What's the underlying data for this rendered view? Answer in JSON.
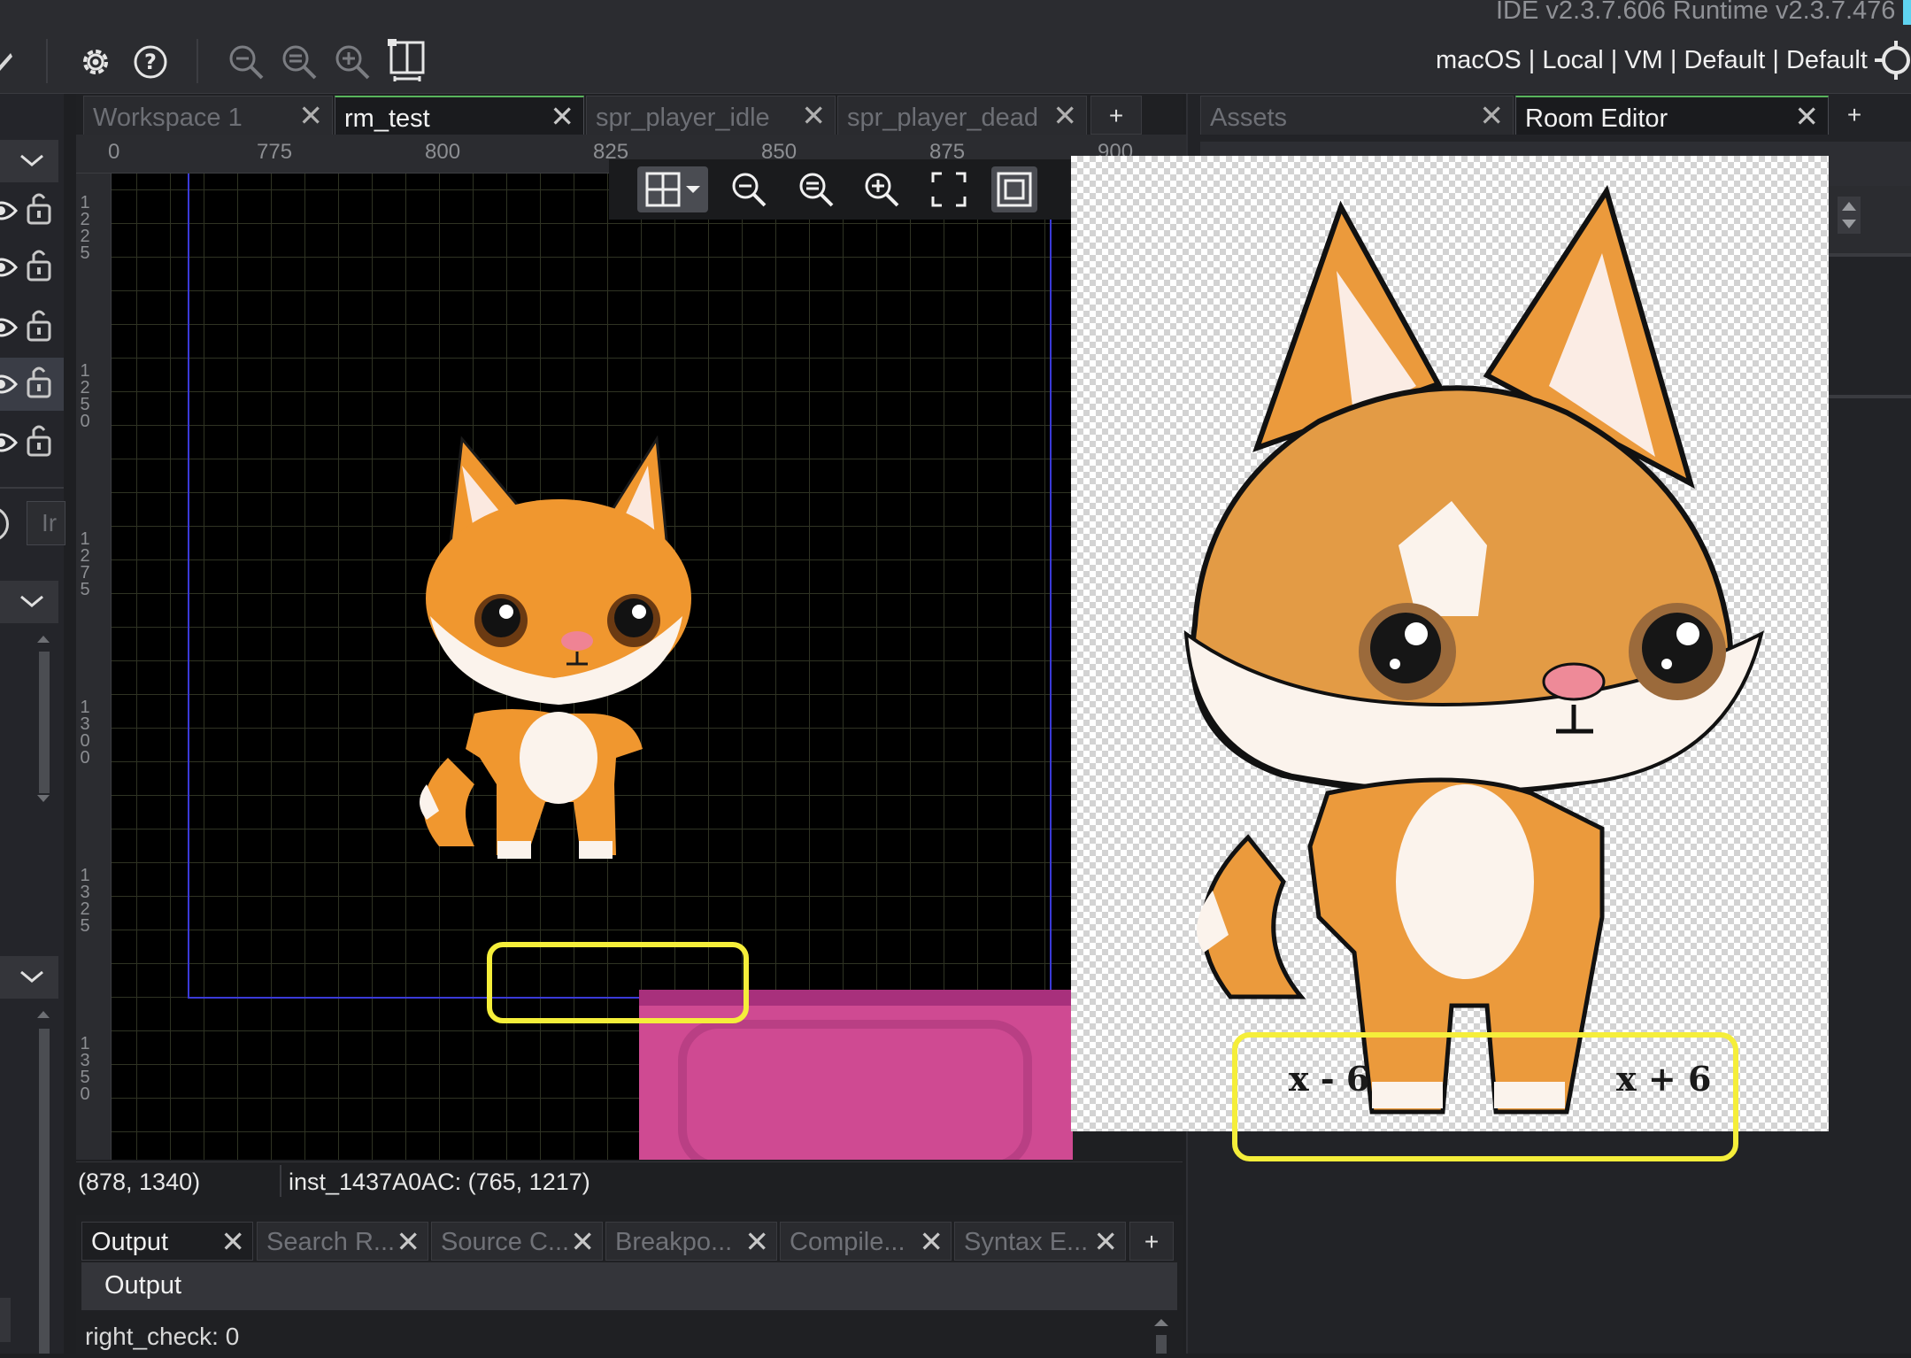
{
  "version_text": "IDE v2.3.7.606  Runtime v2.3.7.476",
  "target_text": "macOS | Local | VM | Default | Default",
  "toolbar": {
    "icons": [
      "gear-icon",
      "help-icon",
      "zoom-out-icon",
      "zoom-reset-icon",
      "zoom-in-icon",
      "grid-layout-icon",
      "target-icon"
    ]
  },
  "workspace_tabs": [
    {
      "label": "Workspace 1",
      "close": "✕"
    },
    {
      "label": "rm_test",
      "close": "✕"
    },
    {
      "label": "spr_player_idle",
      "close": "✕"
    },
    {
      "label": "spr_player_dead",
      "close": "✕"
    }
  ],
  "add_tab": "+",
  "right_tabs": [
    {
      "label": "Assets",
      "close": "✕"
    },
    {
      "label": "Room Editor",
      "close": "✕"
    }
  ],
  "h_ruler": [
    "0",
    "775",
    "800",
    "825",
    "850",
    "875",
    "900"
  ],
  "v_ruler": [
    "1225",
    "1250",
    "1275",
    "1300",
    "1325",
    "1350"
  ],
  "left_panel_field": "Ir",
  "status": {
    "cursor": "(878, 1340)",
    "instance": "inst_1437A0AC: (765, 1217)"
  },
  "output_tabs": [
    {
      "label": "Output",
      "close": "✕"
    },
    {
      "label": "Search R...",
      "close": "✕"
    },
    {
      "label": "Source C...",
      "close": "✕"
    },
    {
      "label": "Breakpo...",
      "close": "✕"
    },
    {
      "label": "Compile...",
      "close": "✕"
    },
    {
      "label": "Syntax E...",
      "close": "✕"
    }
  ],
  "output_header": "Output",
  "output_line": "right_check: 0",
  "annotation": {
    "left_label": "x - 6",
    "right_label": "x + 6",
    "highlight_color": "#f5ee3a"
  },
  "colors": {
    "accent": "#58b45c",
    "room_bounds": "#3a3ad8",
    "platform": "#cf4a92"
  }
}
